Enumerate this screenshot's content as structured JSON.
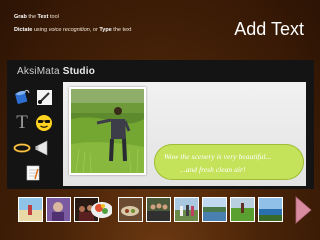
{
  "instructions": {
    "line1": {
      "a": "Grab",
      "b": " the ",
      "c": "Text",
      "d": " tool"
    },
    "line2": {
      "a": "Dictate",
      "b": " using ",
      "c": "voice recognition",
      "d": ", or ",
      "e": "Type",
      "f": " the text"
    }
  },
  "headline": "Add Text",
  "app": {
    "name_a": "AksiMata",
    "name_b": "Studio"
  },
  "tools": [
    {
      "name": "paint-bucket-icon"
    },
    {
      "name": "brush-icon"
    },
    {
      "name": "text-tool-icon",
      "glyph": "T"
    },
    {
      "name": "sunglasses-smiley-icon"
    },
    {
      "name": "halo-ring-icon"
    },
    {
      "name": "megaphone-icon"
    },
    {
      "name": "notepad-icon"
    }
  ],
  "caption": {
    "line1": "Wow the scenery is very beautiful...",
    "line2": "...and fresh clean air!"
  },
  "colors": {
    "bubble": "#c4e25a",
    "arrow": "#d98ba0"
  },
  "thumbnails": [
    {
      "name": "thumb-beach-person"
    },
    {
      "name": "thumb-purple-portrait"
    },
    {
      "name": "thumb-dark-crowd"
    },
    {
      "name": "thumb-food-plate"
    },
    {
      "name": "thumb-dinner-table"
    },
    {
      "name": "thumb-group-photo"
    },
    {
      "name": "thumb-people-outdoor"
    },
    {
      "name": "thumb-lake-scenery"
    },
    {
      "name": "thumb-green-field"
    },
    {
      "name": "thumb-coast-view"
    }
  ]
}
